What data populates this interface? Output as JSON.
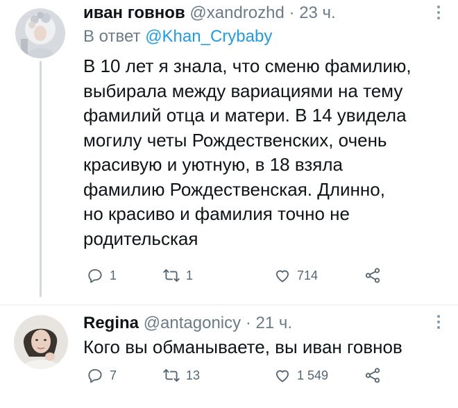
{
  "tweets": [
    {
      "author": {
        "name": "иван говнов",
        "handle": "@xandrozhd",
        "avatar_icon": "profile-photo"
      },
      "separator": "·",
      "time": "23 ч.",
      "reply_to": {
        "prefix": "В ответ",
        "mention": "@Khan_Crybaby"
      },
      "text_lines": [
        "В 10 лет я знала, что сменю фамилию,",
        "выбирала между вариациями на тему",
        "фамилий отца и матери. В 14 увидела",
        "могилу четы Рождественских, очень",
        "красивую и уютную, в 18 взяла",
        "фамилию Рождественская. Длинно,",
        "но красиво и фамилия точно не",
        "родительская"
      ],
      "stats": {
        "replies": "1",
        "retweets": "1",
        "likes": "714"
      }
    },
    {
      "author": {
        "name": "Regina",
        "handle": "@antagonicy",
        "avatar_icon": "profile-photo"
      },
      "separator": "·",
      "time": "21 ч.",
      "text_lines": [
        "Кого вы обманываете, вы иван говнов"
      ],
      "stats": {
        "replies": "7",
        "retweets": "13",
        "likes": "1 549"
      }
    }
  ],
  "colors": {
    "text": "#0f1419",
    "secondary": "#6b7b87",
    "link": "#1d9bf0",
    "thread_line": "#cfd9de"
  }
}
